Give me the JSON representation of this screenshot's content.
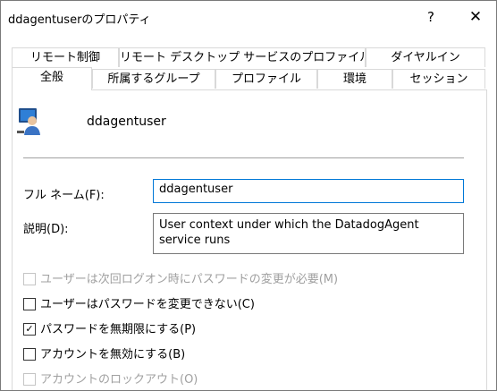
{
  "window": {
    "title": "ddagentuserのプロパティ",
    "help_glyph": "?",
    "close_glyph": "✕"
  },
  "tabs": {
    "row1": [
      {
        "label": "リモート制御"
      },
      {
        "label": "リモート デスクトップ サービスのプロファイル"
      },
      {
        "label": "ダイヤルイン"
      }
    ],
    "row2": [
      {
        "label": "全般",
        "active": true
      },
      {
        "label": "所属するグループ"
      },
      {
        "label": "プロファイル"
      },
      {
        "label": "環境"
      },
      {
        "label": "セッション"
      }
    ]
  },
  "general": {
    "user_icon": "user-icon",
    "username": "ddagentuser",
    "full_name_label": "フル ネーム(F):",
    "full_name_value": "ddagentuser",
    "description_label": "説明(D):",
    "description_value": "User context under which the DatadogAgent service runs",
    "checkboxes": [
      {
        "label": "ユーザーは次回ログオン時にパスワードの変更が必要(M)",
        "checked": false,
        "enabled": false
      },
      {
        "label": "ユーザーはパスワードを変更できない(C)",
        "checked": false,
        "enabled": true
      },
      {
        "label": "パスワードを無期限にする(P)",
        "checked": true,
        "enabled": true
      },
      {
        "label": "アカウントを無効にする(B)",
        "checked": false,
        "enabled": true
      },
      {
        "label": "アカウントのロックアウト(O)",
        "checked": false,
        "enabled": false
      }
    ]
  },
  "colors": {
    "focus_border": "#0078d7",
    "disabled_text": "#a0a0a0"
  }
}
